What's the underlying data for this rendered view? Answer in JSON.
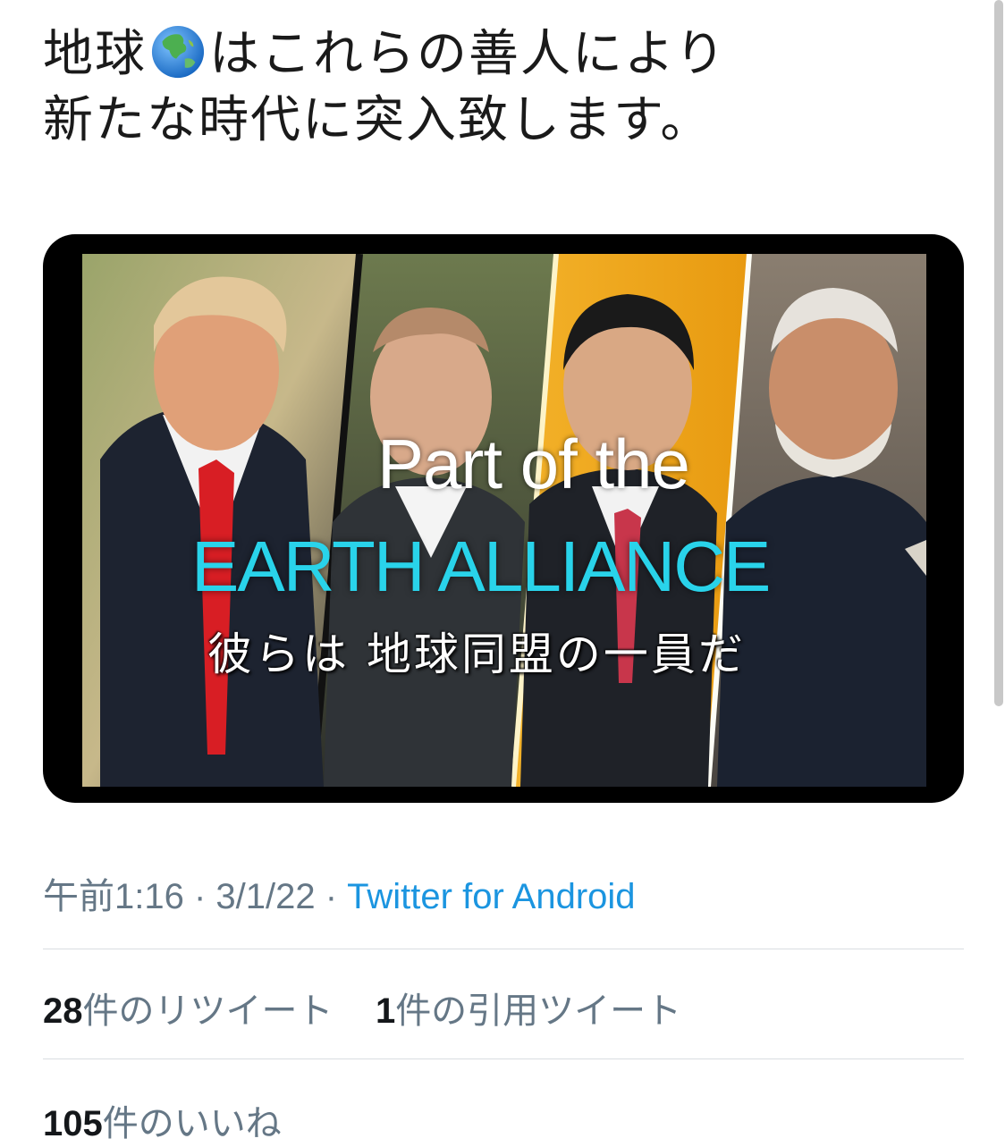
{
  "tweet": {
    "line1_prefix": "地球",
    "line1_suffix": "はこれらの善人により",
    "line2": "新たな時代に突入致します。"
  },
  "media": {
    "caption_line1": "Part of the",
    "caption_line2": "EARTH ALLIANCE",
    "caption_ja": "彼らは 地球同盟の一員だ",
    "colors": {
      "caption_accent": "#29d3ea"
    }
  },
  "meta": {
    "time": "午前1:16",
    "separator1": " · ",
    "date": "3/1/22",
    "separator2": " · ",
    "source": "Twitter for Android"
  },
  "stats": {
    "retweets_count": "28",
    "retweets_label": "件のリツイート",
    "quotes_count": "1",
    "quotes_label": "件の引用ツイート",
    "likes_count": "105",
    "likes_label": "件のいいね"
  },
  "colors": {
    "link": "#1b95e0",
    "muted": "#657786"
  },
  "icons": {
    "globe": "globe-asia-icon"
  }
}
